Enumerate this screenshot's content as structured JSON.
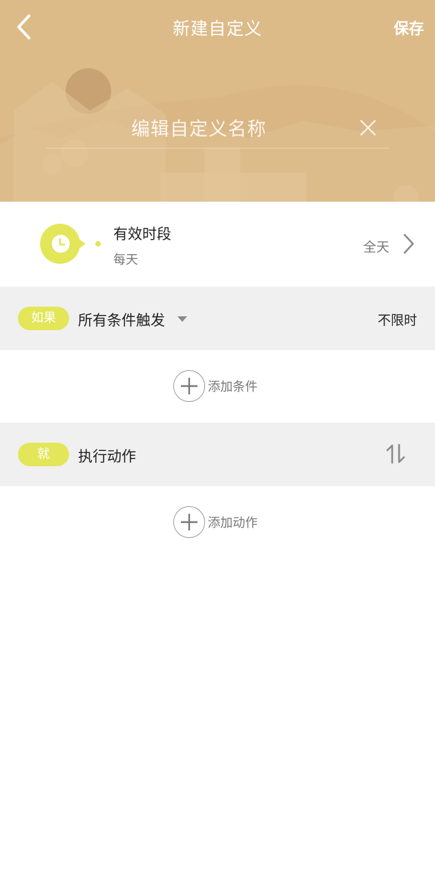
{
  "header": {
    "title": "新建自定义",
    "save_label": "保存",
    "name_placeholder": "编辑自定义名称",
    "name_value": ""
  },
  "time_period": {
    "title": "有效时段",
    "repeat": "每天",
    "range": "全天"
  },
  "condition_section": {
    "badge": "如果",
    "trigger_mode": "所有条件触发",
    "limit": "不限时",
    "add_label": "添加条件"
  },
  "action_section": {
    "badge": "就",
    "title": "执行动作",
    "add_label": "添加动作"
  },
  "icons": {
    "back": "chevron-left-icon",
    "clear": "close-icon",
    "clock": "clock-icon",
    "chevron": "chevron-right-icon",
    "dropdown": "caret-down-icon",
    "sort": "sort-arrows-icon",
    "add": "plus-icon"
  },
  "colors": {
    "header_bg": "#dcbb89",
    "accent": "#e2e658",
    "section_bg": "#f0f0f0"
  }
}
